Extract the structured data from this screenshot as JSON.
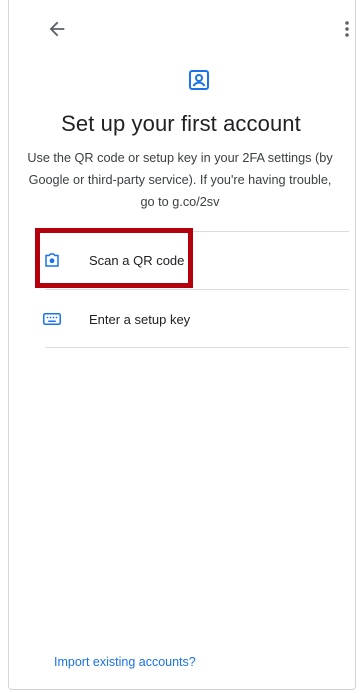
{
  "header": {
    "back_icon": "arrow-back-icon",
    "more_icon": "more-vert-icon"
  },
  "hero": {
    "icon": "account-box-icon",
    "title": "Set up your first account",
    "description": "Use the QR code or setup key in your 2FA settings (by Google or third-party service). If you're having trouble, go to g.co/2sv"
  },
  "options": [
    {
      "icon": "camera-icon",
      "label": "Scan a QR code"
    },
    {
      "icon": "keyboard-icon",
      "label": "Enter a setup key"
    }
  ],
  "footer": {
    "import_label": "Import existing accounts?"
  },
  "colors": {
    "accent": "#1a73e8",
    "highlight": "#b3000c",
    "text": "#202124"
  }
}
